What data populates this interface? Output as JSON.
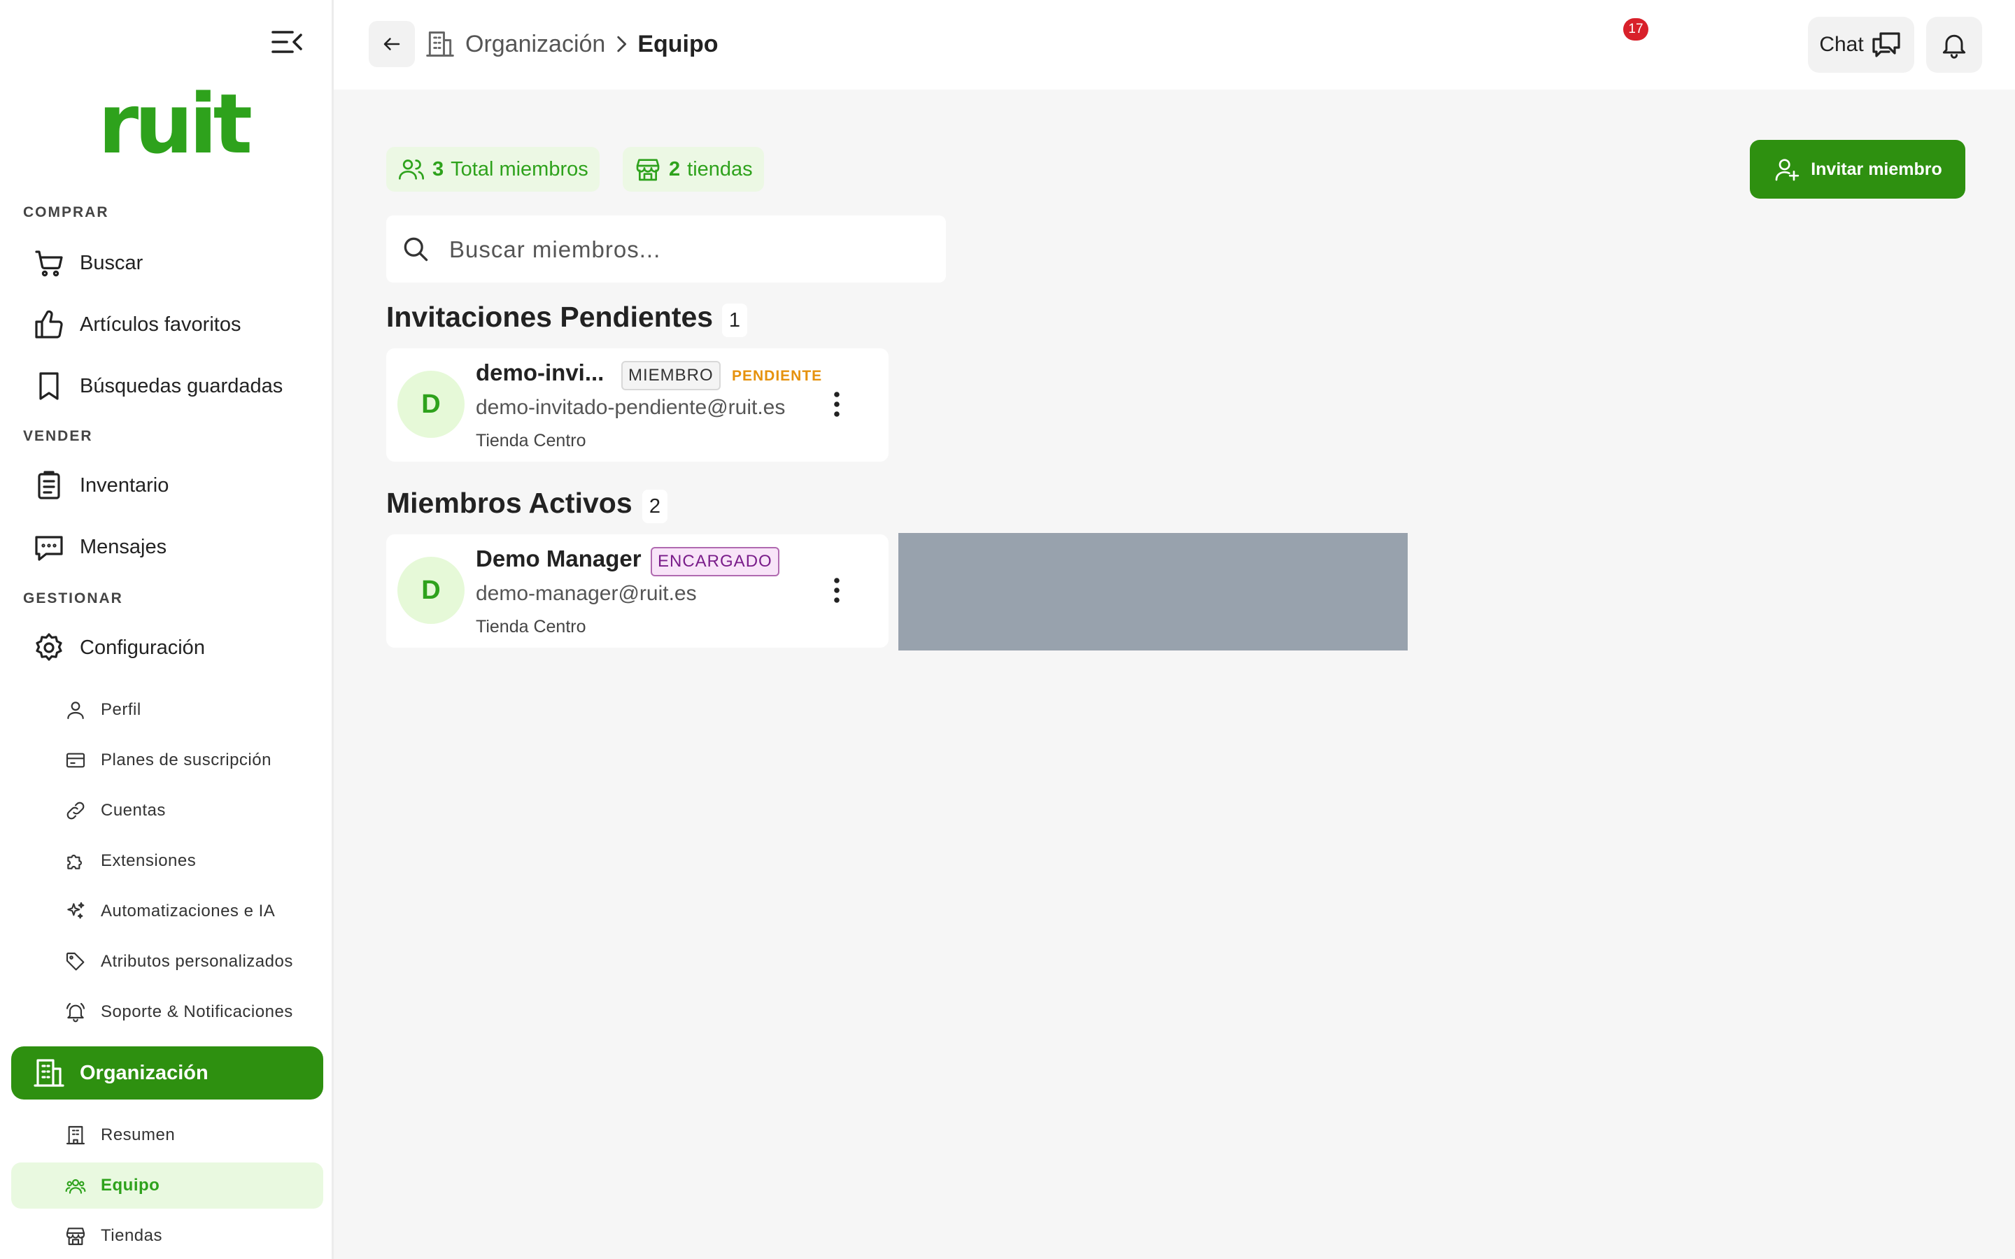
{
  "app": {
    "brand": "ruit",
    "brand_color": "#2ea21c",
    "accent": "#2e9010"
  },
  "sidebar": {
    "sections": {
      "comprar": "COMPRAR",
      "vender": "VENDER",
      "gestionar": "GESTIONAR"
    },
    "items": {
      "buscar": "Buscar",
      "favoritos": "Artículos favoritos",
      "busquedas": "Búsquedas guardadas",
      "inventario": "Inventario",
      "mensajes": "Mensajes",
      "configuracion": "Configuración",
      "organizacion": "Organización"
    },
    "sub_config": {
      "perfil": "Perfil",
      "planes": "Planes de suscripción",
      "cuentas": "Cuentas",
      "extensiones": "Extensiones",
      "automatizaciones": "Automatizaciones e IA",
      "atributos": "Atributos personalizados",
      "soporte": "Soporte & Notificaciones"
    },
    "sub_org": {
      "resumen": "Resumen",
      "equipo": "Equipo",
      "tiendas": "Tiendas"
    }
  },
  "header": {
    "breadcrumb_root": "Organización",
    "breadcrumb_current": "Equipo",
    "chat_label": "Chat",
    "notification_count": "17"
  },
  "stats": {
    "members_count": "3",
    "members_label": "Total miembros",
    "stores_count": "2",
    "stores_label": "tiendas"
  },
  "actions": {
    "invite_label": "Invitar miembro"
  },
  "search": {
    "placeholder": "Buscar miembros..."
  },
  "pending": {
    "title": "Invitaciones Pendientes",
    "count": "1",
    "members": [
      {
        "initial": "D",
        "name": "demo-invi...",
        "role": "MIEMBRO",
        "status": "PENDIENTE",
        "email": "demo-invitado-pendiente@ruit.es",
        "store": "Tienda Centro"
      }
    ]
  },
  "active": {
    "title": "Miembros Activos",
    "count": "2",
    "members": [
      {
        "initial": "D",
        "name": "Demo Manager",
        "role": "ENCARGADO",
        "email": "demo-manager@ruit.es",
        "store": "Tienda Centro"
      }
    ]
  }
}
